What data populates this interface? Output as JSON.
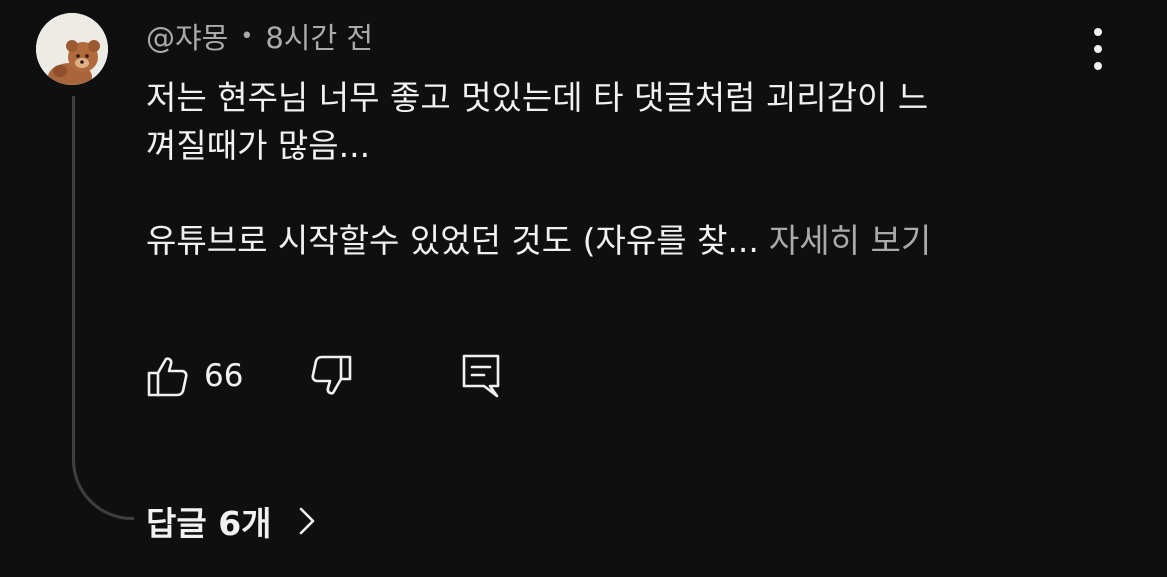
{
  "comment": {
    "handle": "@쟈몽",
    "separator": "•",
    "time": "8시간 전",
    "text_line_1": "저는 현주님 너무 좋고 멋있는데 타 댓글처럼 괴리감이 느",
    "text_line_2": "껴질때가 많음...",
    "text_line_3": "유튜브로 시작할수 있었던 것도 (자유를 찾...",
    "read_more": "자세히 보기",
    "like_count": "66",
    "replies_label": "답글 6개"
  },
  "icons": {
    "avatar": "teddy-bear-avatar",
    "more": "vertical-ellipsis-icon",
    "like": "thumbs-up-icon",
    "dislike": "thumbs-down-icon",
    "reply": "reply-comment-icon",
    "replies_chevron": "chevron-right-icon"
  },
  "colors": {
    "background": "#0f0f0f",
    "primary_text": "#f1f1f1",
    "secondary_text": "#aaaaaa",
    "thread_line": "#3f3f3f"
  }
}
